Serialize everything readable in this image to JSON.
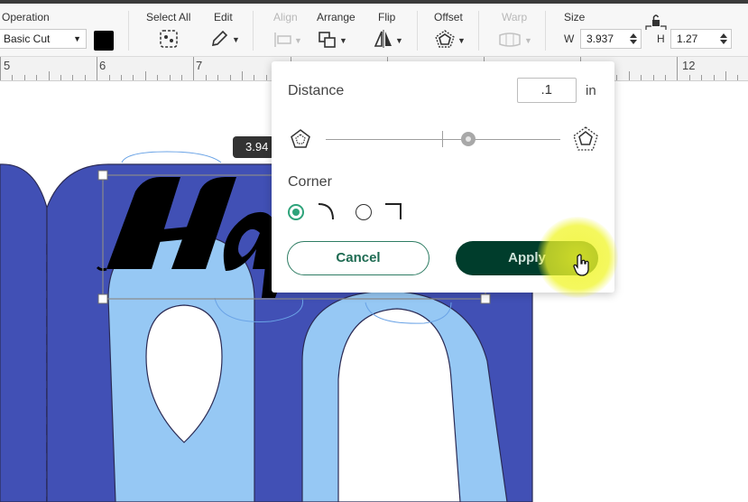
{
  "toolbar": {
    "operation_label": "Operation",
    "operation_value": "Basic Cut",
    "color_swatch": "#000000",
    "select_all_label": "Select All",
    "edit_label": "Edit",
    "align_label": "Align",
    "arrange_label": "Arrange",
    "flip_label": "Flip",
    "offset_label": "Offset",
    "warp_label": "Warp",
    "size_label": "Size",
    "width_prefix": "W",
    "width_value": "3.937",
    "height_prefix": "H",
    "height_value": "1.27",
    "icons": [
      "select-all-icon",
      "pencil-icon",
      "align-icon",
      "arrange-icon",
      "flip-icon",
      "offset-icon",
      "warp-icon",
      "lock-icon"
    ]
  },
  "ruler": {
    "numbers": [
      "5",
      "6",
      "7",
      "12"
    ]
  },
  "canvas": {
    "dimension_badge": "3.94",
    "colors": {
      "dark_blue": "#4150b5",
      "light_blue": "#96c8f4",
      "selection": "#8a8a8a"
    }
  },
  "offset_popup": {
    "distance_label": "Distance",
    "distance_value": ".1",
    "unit": "in",
    "corner_label": "Corner",
    "corner_options": [
      "rounded",
      "square"
    ],
    "corner_selected": "rounded",
    "cancel_label": "Cancel",
    "apply_label": "Apply",
    "accent_color": "#2ea37a",
    "apply_color": "#003d2c"
  }
}
